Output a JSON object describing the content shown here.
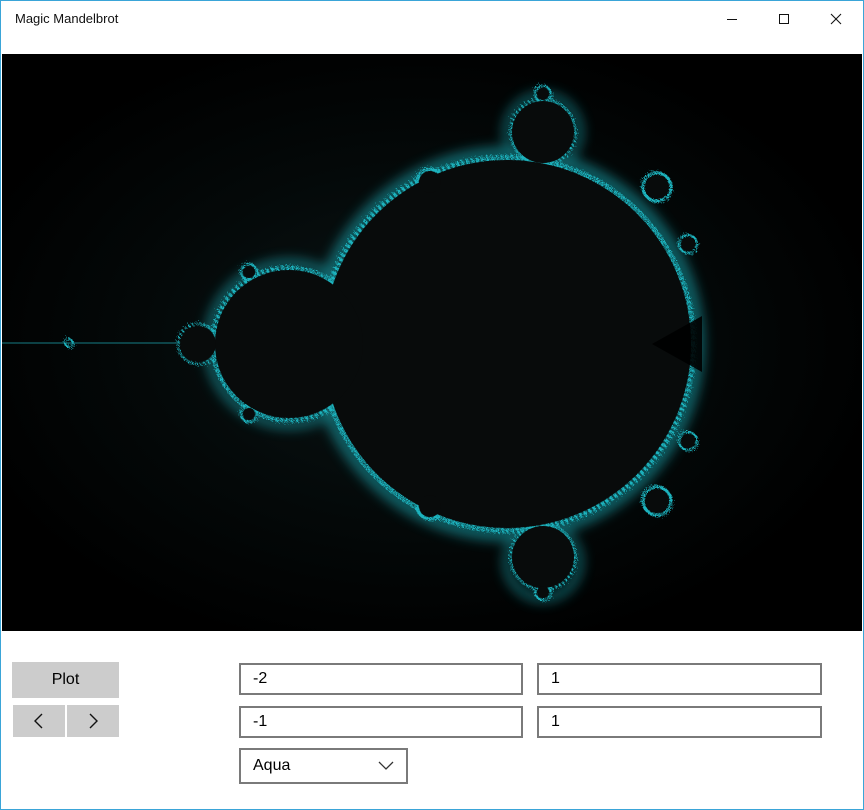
{
  "window": {
    "title": "Magic Mandelbrot",
    "accent_color": "#3aa5d8"
  },
  "icons": {
    "minimize": "minimize-icon",
    "maximize": "maximize-icon",
    "close": "close-icon",
    "previous": "chevron-left-icon",
    "next": "chevron-right-icon",
    "dropdown": "chevron-down-icon"
  },
  "controls": {
    "plot_label": "Plot",
    "real_min": "-2",
    "real_max": "1",
    "imag_min": "-1",
    "imag_max": "1",
    "color_scheme": "Aqua"
  },
  "fractal": {
    "background_color": "#000000",
    "set_color": "#080b0b",
    "edge_color": "#1fb3be"
  }
}
